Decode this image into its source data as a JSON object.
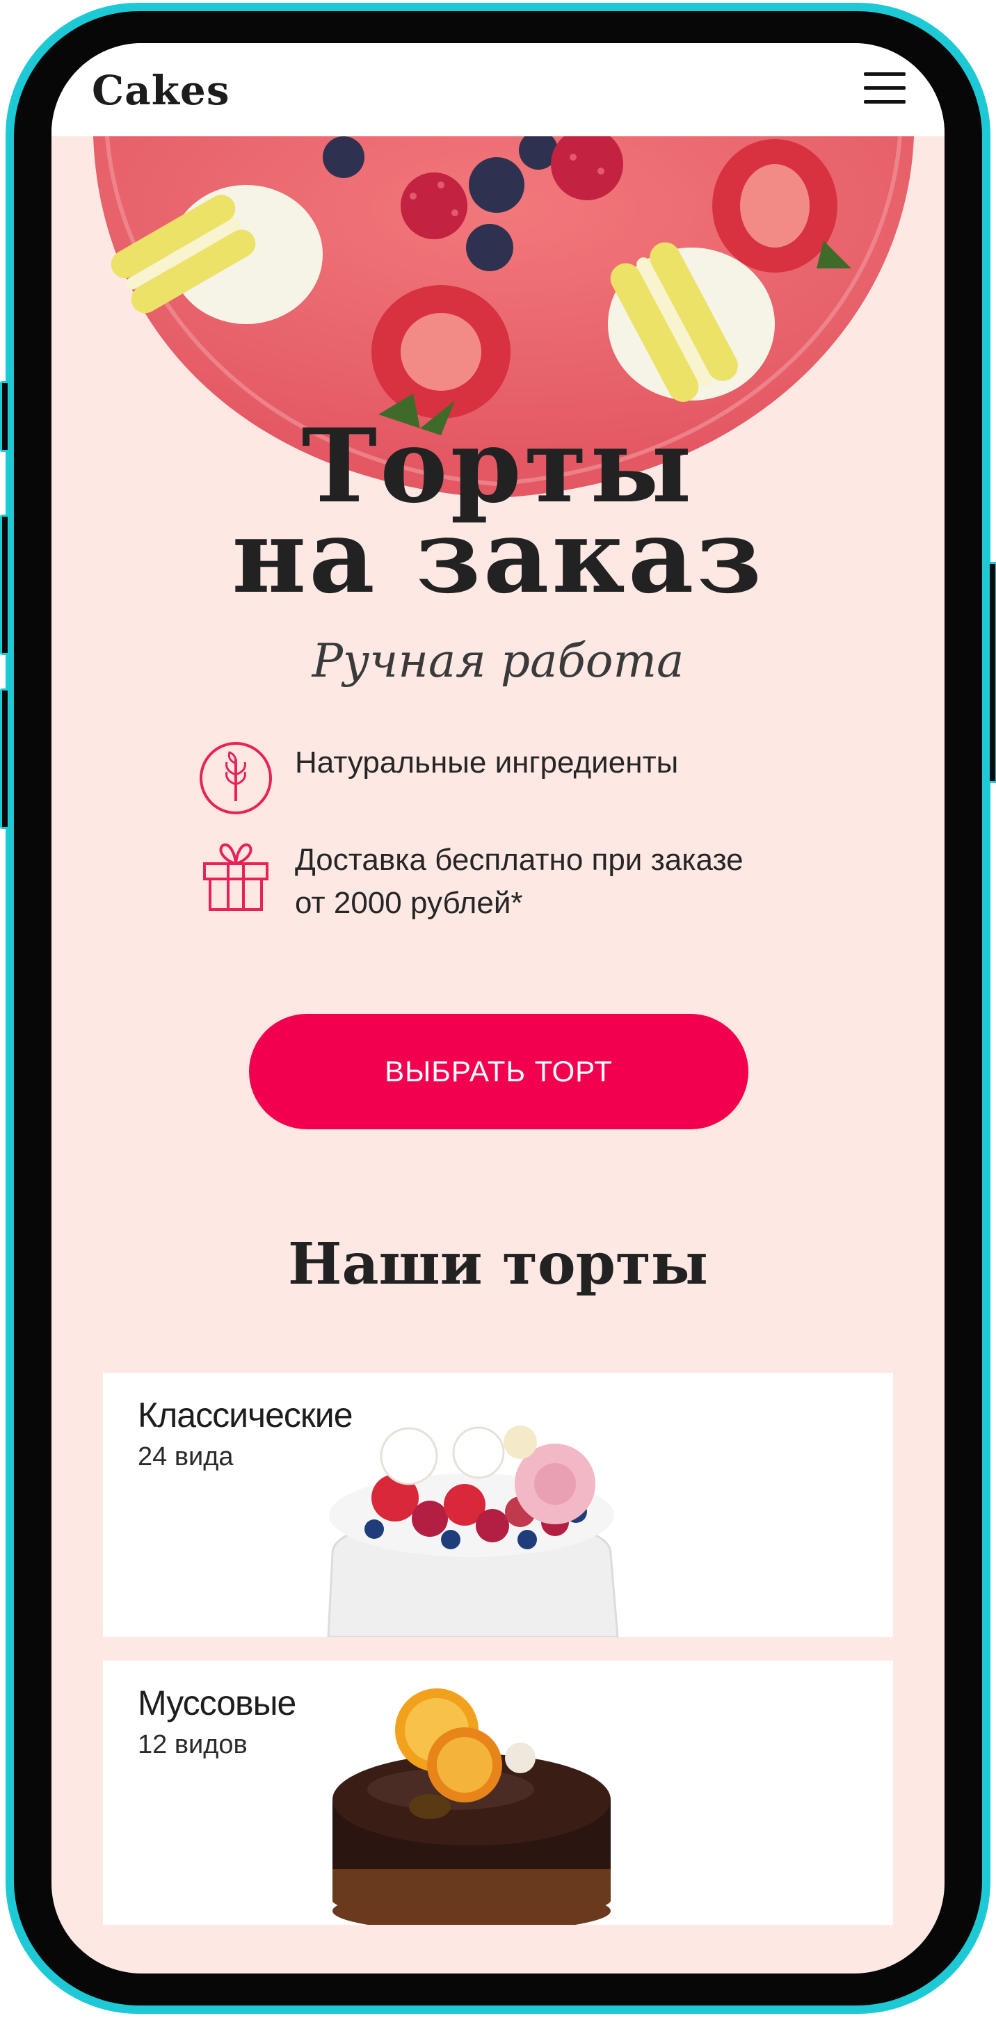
{
  "header": {
    "logo": "Cakes",
    "menu_icon": "hamburger-menu-icon"
  },
  "hero": {
    "title_line1": "Торты",
    "title_line2": "на заказ",
    "subtitle": "Ручная работа"
  },
  "features": [
    {
      "icon": "wheat-icon",
      "text": "Натуральные ингредиенты"
    },
    {
      "icon": "gift-icon",
      "text_line1": "Доставка бесплатно при заказе",
      "text_line2": "от 2000 рублей*"
    }
  ],
  "cta": {
    "label": "ВЫБРАТЬ ТОРТ"
  },
  "catalog": {
    "title": "Наши торты",
    "cards": [
      {
        "title": "Классические",
        "count": "24 вида"
      },
      {
        "title": "Муссовые",
        "count": "12 видов"
      }
    ]
  },
  "colors": {
    "accent": "#f2004f",
    "background": "#fde8e4",
    "frame": "#1ec9d6"
  }
}
